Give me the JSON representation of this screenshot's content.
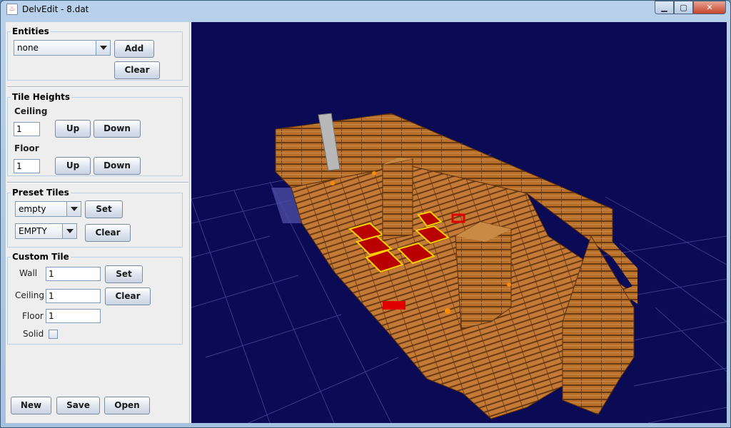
{
  "window": {
    "title": "DelvEdit - 8.dat",
    "app_icon_glyph": "♨",
    "minimize_glyph": "▁",
    "maximize_glyph": "▢",
    "close_glyph": "✕"
  },
  "entities": {
    "legend": "Entities",
    "selected": "none",
    "add_label": "Add",
    "clear_label": "Clear"
  },
  "tile_heights": {
    "legend": "Tile Heights",
    "ceiling_label": "Ceiling",
    "ceiling_value": "1",
    "floor_label": "Floor",
    "floor_value": "1",
    "up_label": "Up",
    "down_label": "Down"
  },
  "preset_tiles": {
    "legend": "Preset Tiles",
    "tile_selected": "empty",
    "type_selected": "EMPTY",
    "set_label": "Set",
    "clear_label": "Clear"
  },
  "custom_tile": {
    "legend": "Custom Tile",
    "wall_label": "Wall",
    "wall_value": "1",
    "ceiling_label": "Ceiling",
    "ceiling_value": "1",
    "floor_label": "Floor",
    "floor_value": "1",
    "solid_label": "Solid",
    "solid_checked": false,
    "set_label": "Set",
    "clear_label": "Clear"
  },
  "file_buttons": {
    "new_label": "New",
    "save_label": "Save",
    "open_label": "Open"
  },
  "colors": {
    "viewport_bg": "#0a0a55",
    "grid_line": "#3a3a8a",
    "wood": "#b8702a",
    "wood_dark": "#6a3a12",
    "red_tile": "#b80000",
    "tile_outline": "#ffd000"
  }
}
